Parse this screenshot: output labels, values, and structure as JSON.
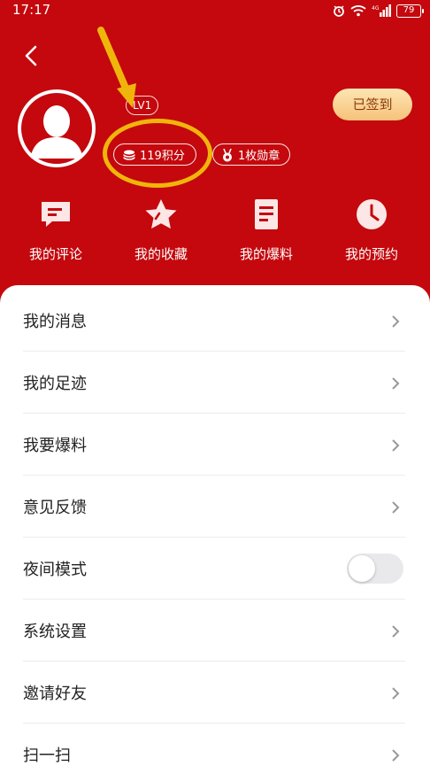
{
  "status_bar": {
    "time": "17:17",
    "battery": "79"
  },
  "profile": {
    "level": "LV1",
    "points": "119积分",
    "medals": "1枚勋章",
    "checkin_label": "已签到"
  },
  "quick_actions": [
    {
      "label": "我的评论",
      "icon": "comment-icon"
    },
    {
      "label": "我的收藏",
      "icon": "star-icon"
    },
    {
      "label": "我的爆料",
      "icon": "document-icon"
    },
    {
      "label": "我的预约",
      "icon": "clock-icon"
    }
  ],
  "menu": [
    {
      "label": "我的消息",
      "type": "link"
    },
    {
      "label": "我的足迹",
      "type": "link"
    },
    {
      "label": "我要爆料",
      "type": "link"
    },
    {
      "label": "意见反馈",
      "type": "link"
    },
    {
      "label": "夜间模式",
      "type": "toggle",
      "on": false
    },
    {
      "label": "系统设置",
      "type": "link"
    },
    {
      "label": "邀请好友",
      "type": "link"
    },
    {
      "label": "扫一扫",
      "type": "link"
    }
  ],
  "colors": {
    "header_bg": "#c4080d",
    "checkin_bg": "#f6c27a",
    "annotation": "#f0b50b"
  }
}
